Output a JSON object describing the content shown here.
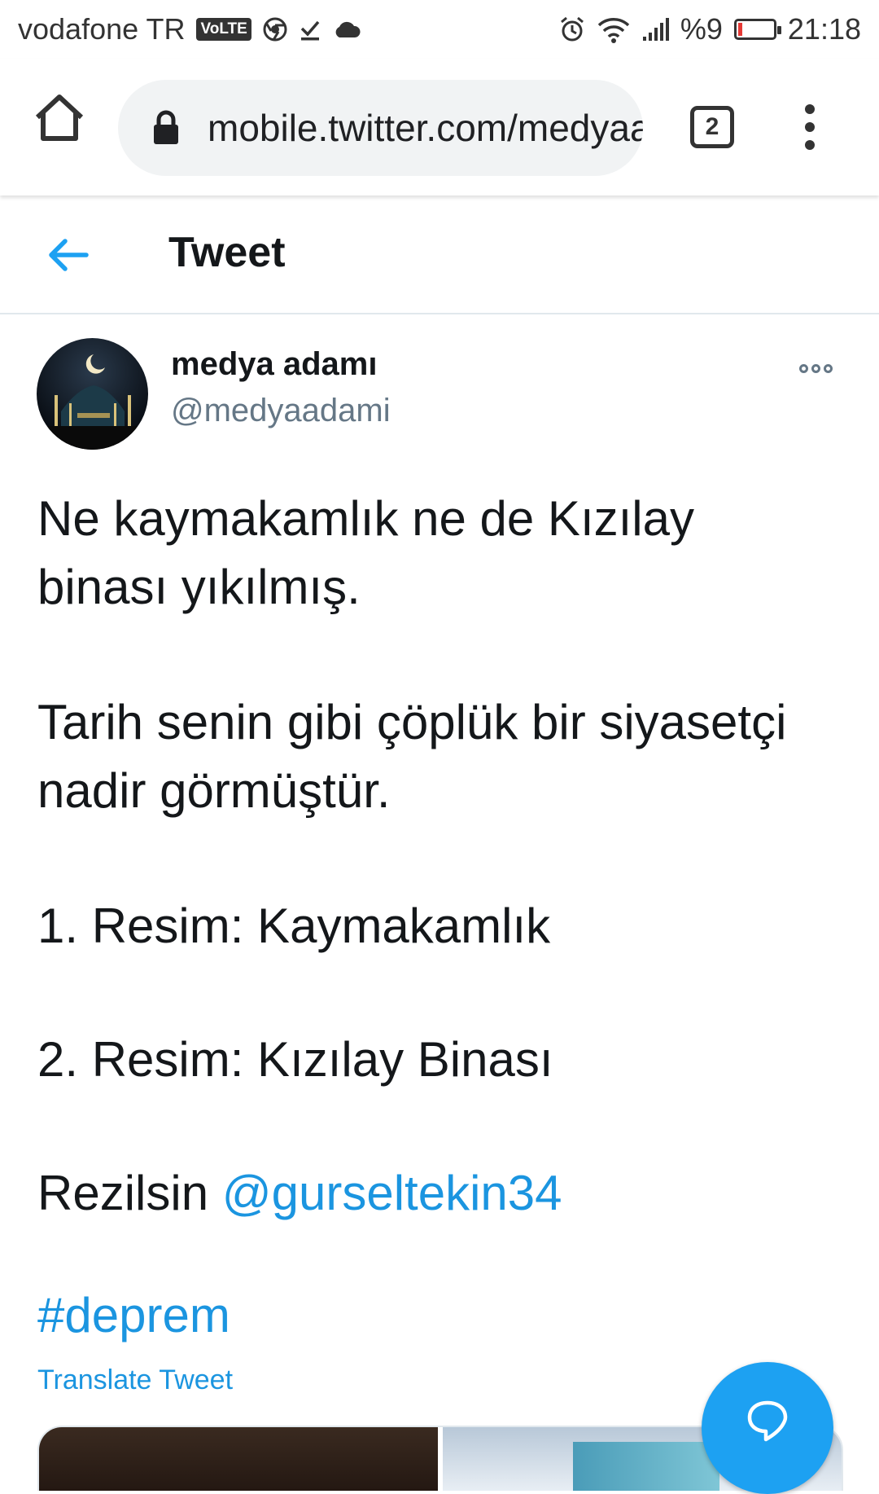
{
  "status_bar": {
    "carrier": "vodafone TR",
    "volte": "VoLTE",
    "battery_percent": "%9",
    "battery_level": 0.09,
    "time": "21:18",
    "icons": [
      "chrome-icon",
      "download-done-icon",
      "cloud-icon",
      "alarm-icon",
      "wifi-icon",
      "signal-icon",
      "battery-icon"
    ]
  },
  "browser": {
    "url": "mobile.twitter.com/medyaadami/status",
    "tab_count": "2"
  },
  "header": {
    "title": "Tweet"
  },
  "tweet": {
    "display_name": "medya adamı",
    "handle": "@medyaadami",
    "paragraphs": [
      "Ne kaymakamlık ne de Kızılay binası yıkılmış.",
      "Tarih senin gibi çöplük bir siyasetçi nadir görmüştür.",
      "1. Resim: Kaymakamlık",
      "2. Resim: Kızılay Binası"
    ],
    "last_line_prefix": "Rezilsin ",
    "mention": "@gurseltekin34",
    "hashtag": "#deprem",
    "translate_label": "Translate Tweet"
  },
  "colors": {
    "accent": "#1da1f2",
    "link": "#1b95e0",
    "secondary_text": "#657786"
  }
}
